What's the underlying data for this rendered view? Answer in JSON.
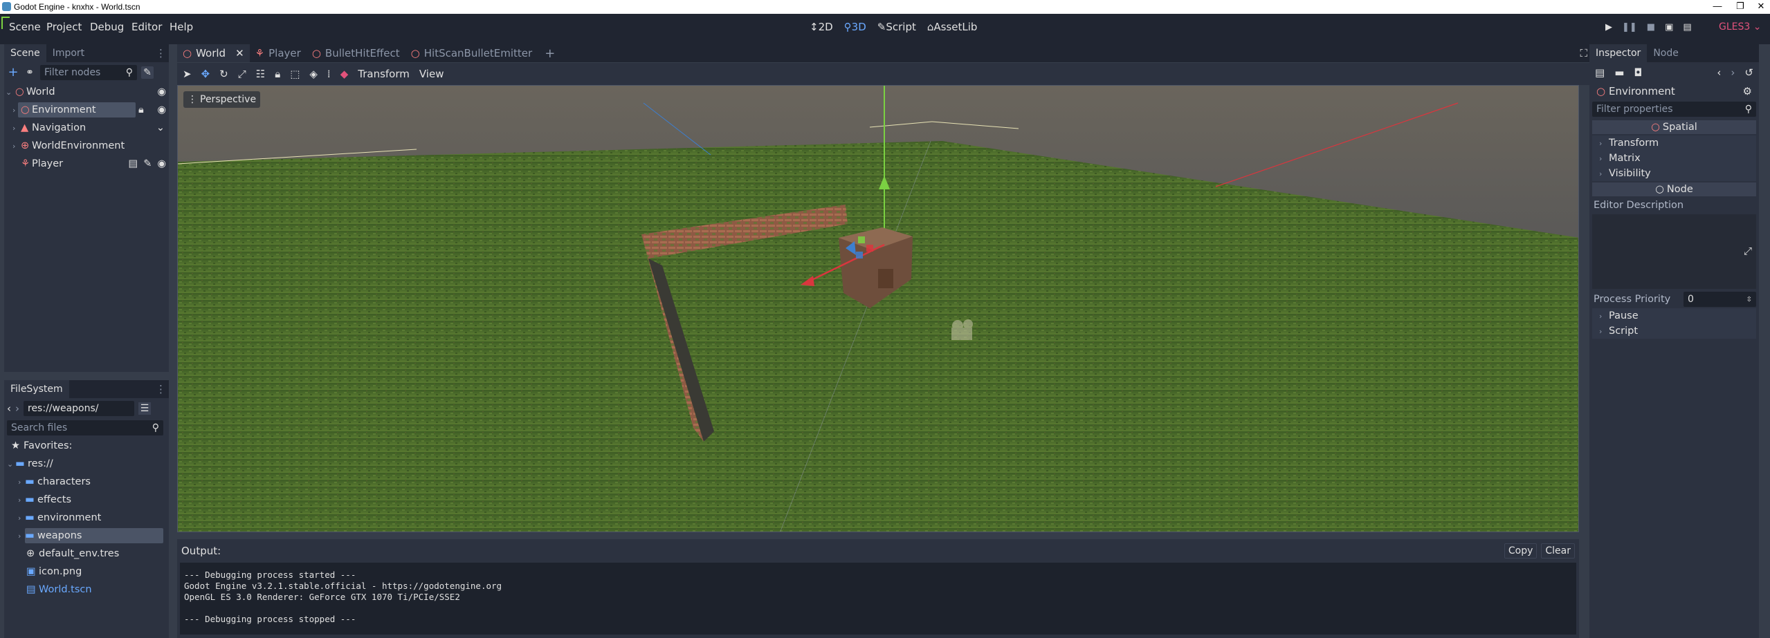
{
  "window": {
    "title": "Godot Engine - knxhx - World.tscn"
  },
  "menu": {
    "items": [
      "Scene",
      "Project",
      "Debug",
      "Editor",
      "Help"
    ]
  },
  "main_screens": {
    "d2": "2D",
    "d3": "3D",
    "script": "Script",
    "assetlib": "AssetLib"
  },
  "renderer": "GLES3",
  "scene_dock": {
    "tab_scene": "Scene",
    "tab_import": "Import",
    "filter_placeholder": "Filter nodes",
    "tree": [
      {
        "label": "World",
        "icon": "spatial-icon",
        "color": "#fc7f7f"
      },
      {
        "label": "Environment",
        "icon": "spatial-icon",
        "color": "#fc7f7f"
      },
      {
        "label": "Navigation",
        "icon": "navigation-icon",
        "color": "#fc7f7f"
      },
      {
        "label": "WorldEnvironment",
        "icon": "globe-icon",
        "color": "#fc7f7f"
      },
      {
        "label": "Player",
        "icon": "player-icon",
        "color": "#fc7f7f"
      }
    ]
  },
  "filesystem": {
    "tab": "FileSystem",
    "path": "res://weapons/",
    "search_placeholder": "Search files",
    "favorites": "Favorites:",
    "root": "res://",
    "folders": [
      "characters",
      "effects",
      "environment",
      "weapons"
    ],
    "files": [
      "default_env.tres",
      "icon.png",
      "World.tscn"
    ]
  },
  "editor_tabs": [
    "World",
    "Player",
    "BulletHitEffect",
    "HitScanBulletEmitter"
  ],
  "viewport": {
    "menu_transform": "Transform",
    "menu_view": "View",
    "perspective": "Perspective"
  },
  "output": {
    "label": "Output:",
    "copy": "Copy",
    "clear": "Clear",
    "lines": [
      "--- Debugging process started ---",
      "Godot Engine v3.2.1.stable.official - https://godotengine.org",
      "OpenGL ES 3.0 Renderer: GeForce GTX 1070 Ti/PCIe/SSE2",
      "",
      "--- Debugging process stopped ---"
    ]
  },
  "inspector": {
    "tab_inspector": "Inspector",
    "tab_node": "Node",
    "object": "Environment",
    "filter_placeholder": "Filter properties",
    "section_spatial": "Spatial",
    "spatial_props": [
      "Transform",
      "Matrix",
      "Visibility"
    ],
    "section_node": "Node",
    "editor_description": "Editor Description",
    "process_priority_label": "Process Priority",
    "process_priority_value": "0",
    "node_props": [
      "Pause",
      "Script"
    ]
  },
  "colors": {
    "accent": "#6aa9ff",
    "node_red": "#fc7f7f",
    "renderer": "#e2527b",
    "folder": "#6aa9ff"
  }
}
